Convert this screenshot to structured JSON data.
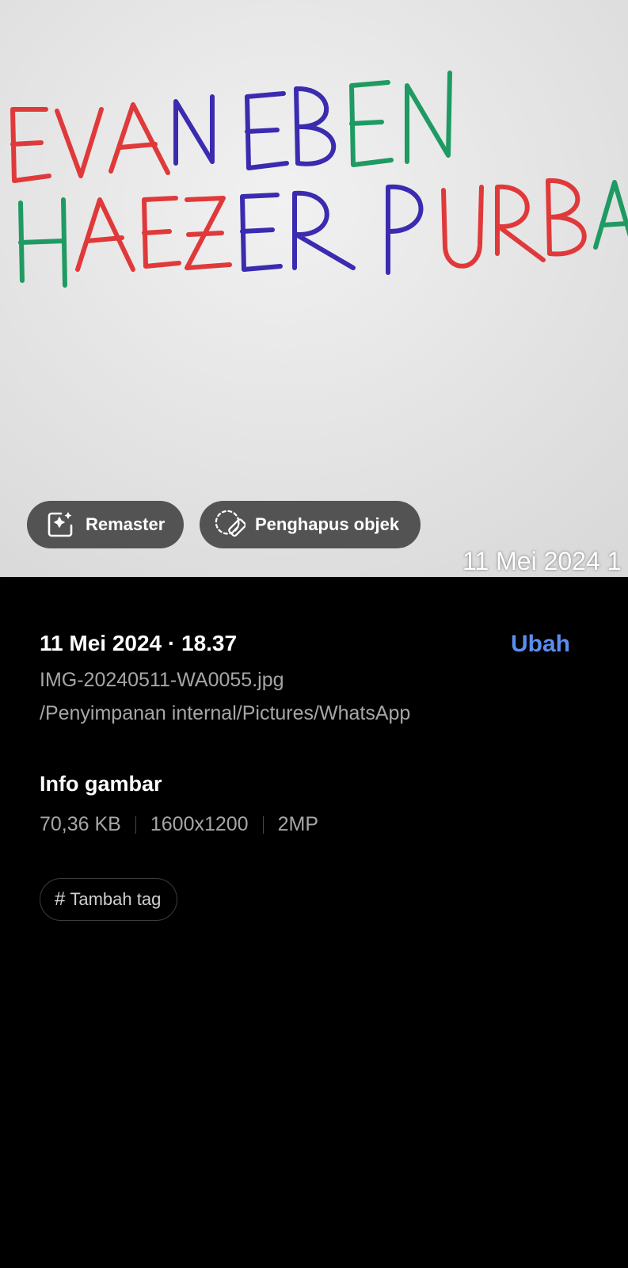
{
  "photo": {
    "handwriting_line1": "EVAN EBEN",
    "handwriting_line2": "HAEZER PURBA",
    "timestamp_overlay": "11 Mei 2024 1",
    "colors": {
      "red": "#e0393a",
      "green": "#1f9a62",
      "blue": "#3a2bb0"
    }
  },
  "actions": {
    "remaster_label": "Remaster",
    "remaster_icon": "sparkle-edit-icon",
    "object_eraser_label": "Penghapus objek",
    "object_eraser_icon": "eraser-icon"
  },
  "details": {
    "date_time": "11 Mei 2024 · 18.37",
    "edit_label": "Ubah",
    "file_name": "IMG-20240511-WA0055.jpg",
    "file_path": "/Penyimpanan internal/Pictures/WhatsApp",
    "info_title": "Info gambar",
    "file_size": "70,36 KB",
    "resolution": "1600x1200",
    "megapixels": "2MP",
    "add_tag_label": "Tambah tag",
    "accent_color": "#5b8def"
  }
}
